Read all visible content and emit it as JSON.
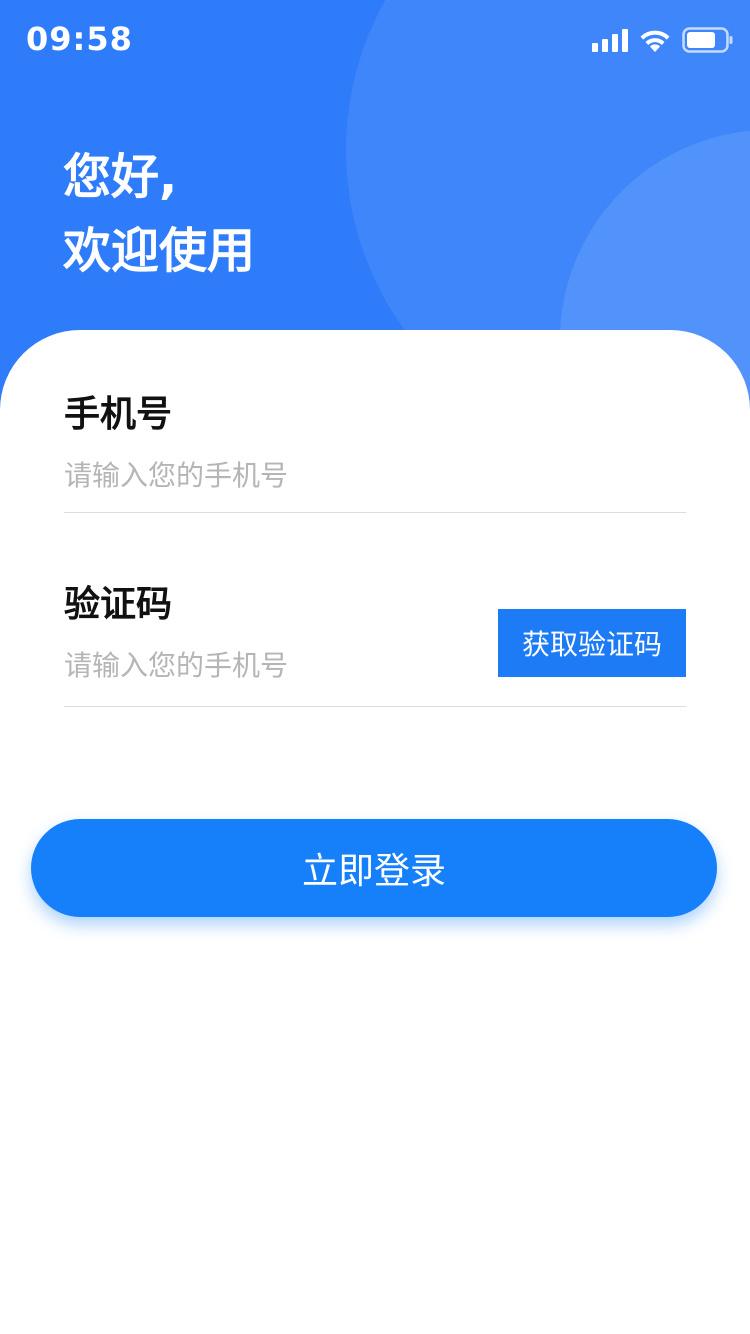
{
  "status_bar": {
    "time": "09:58",
    "signal_icon": "signal-bars-icon",
    "wifi_icon": "wifi-icon",
    "battery_icon": "battery-icon"
  },
  "greeting": {
    "line1": "您好,",
    "line2": "欢迎使用"
  },
  "form": {
    "phone": {
      "label": "手机号",
      "placeholder": "请输入您的手机号",
      "value": ""
    },
    "code": {
      "label": "验证码",
      "placeholder": "请输入您的手机号",
      "value": "",
      "get_code_label": "获取验证码"
    },
    "login_label": "立即登录"
  },
  "colors": {
    "header_blue": "#2f7cfb",
    "accent_blue": "#1680fb",
    "label_text": "#111111",
    "placeholder_text": "#b5b5b5",
    "divider": "#dedede"
  }
}
